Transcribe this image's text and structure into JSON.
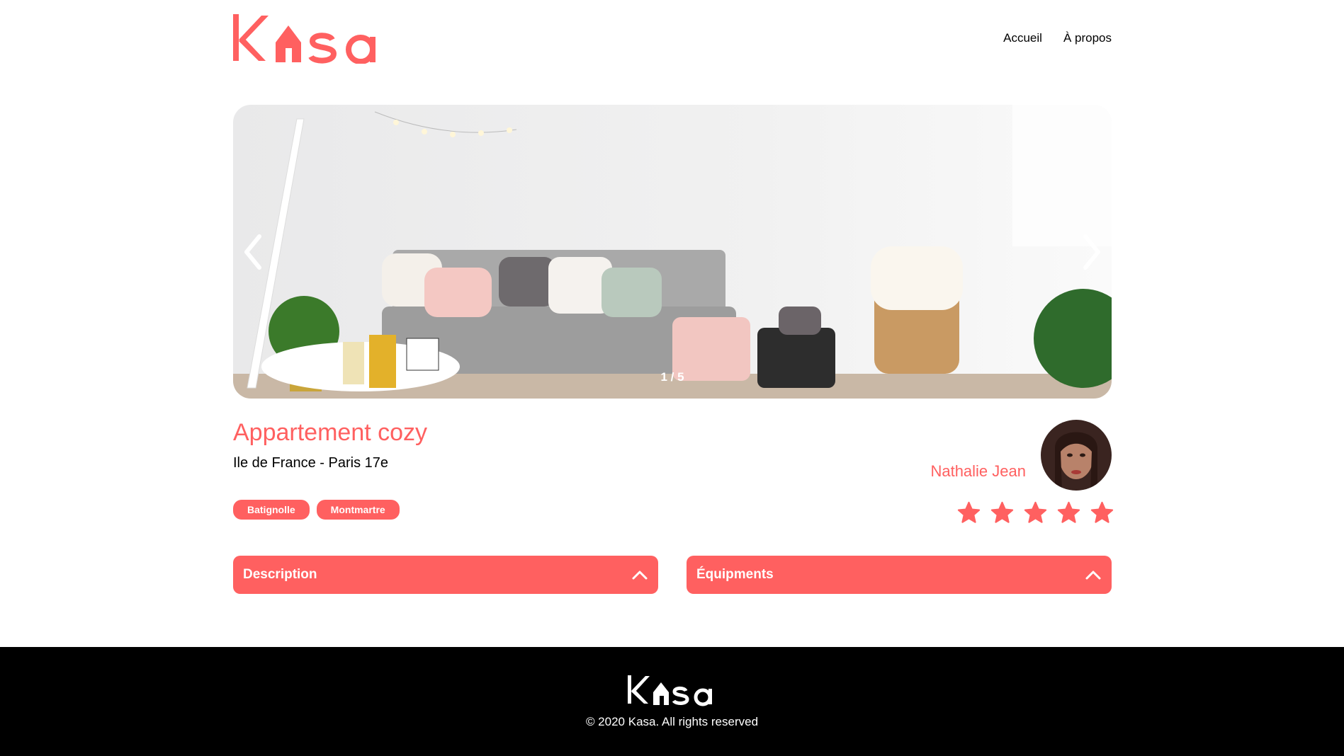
{
  "brand": {
    "name": "Kasa",
    "accent_color": "#FF6060"
  },
  "nav": {
    "home_label": "Accueil",
    "about_label": "À propos"
  },
  "carousel": {
    "counter": "1 / 5",
    "prev_icon": "chevron-left-icon",
    "next_icon": "chevron-right-icon"
  },
  "listing": {
    "title": "Appartement cozy",
    "location": "Ile de France - Paris 17e",
    "tags": [
      "Batignolle",
      "Montmartre"
    ],
    "host": {
      "name": "Nathalie Jean"
    },
    "rating": 5,
    "rating_max": 5
  },
  "collapses": {
    "description_label": "Description",
    "equipments_label": "Équipments"
  },
  "footer": {
    "copyright": "© 2020 Kasa. All rights reserved"
  }
}
